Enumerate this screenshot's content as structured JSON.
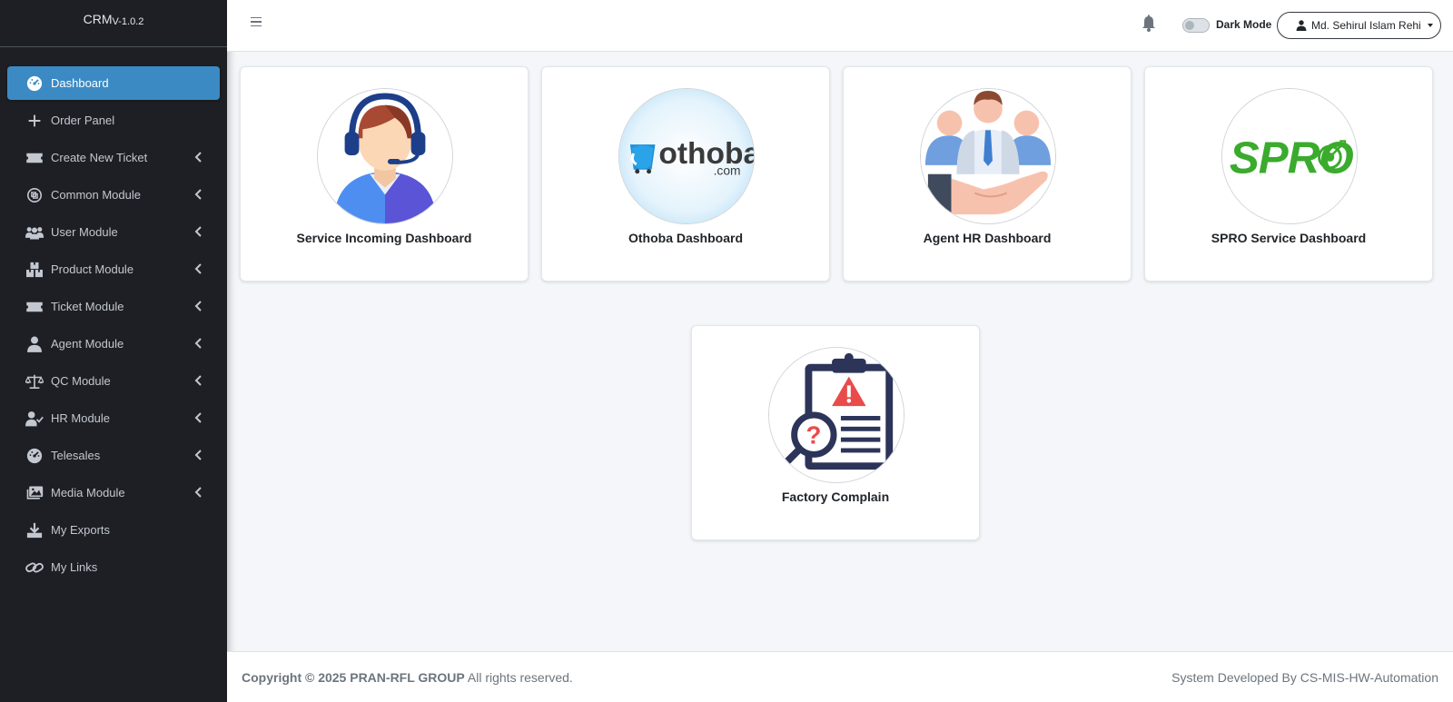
{
  "brand": {
    "name": "CRM",
    "version": "V-1.0.2"
  },
  "sidebar": {
    "items": [
      {
        "label": "Dashboard",
        "icon": "gauge-icon",
        "active": true,
        "has_submenu": false
      },
      {
        "label": "Order Panel",
        "icon": "plus-icon",
        "active": false,
        "has_submenu": false
      },
      {
        "label": "Create New Ticket",
        "icon": "ticket-icon",
        "active": false,
        "has_submenu": true
      },
      {
        "label": "Common Module",
        "icon": "copyright-icon",
        "active": false,
        "has_submenu": true
      },
      {
        "label": "User Module",
        "icon": "users-icon",
        "active": false,
        "has_submenu": true
      },
      {
        "label": "Product Module",
        "icon": "boxes-icon",
        "active": false,
        "has_submenu": true
      },
      {
        "label": "Ticket Module",
        "icon": "ticket-icon",
        "active": false,
        "has_submenu": true
      },
      {
        "label": "Agent Module",
        "icon": "user-icon",
        "active": false,
        "has_submenu": true
      },
      {
        "label": "QC Module",
        "icon": "balance-scale-icon",
        "active": false,
        "has_submenu": true
      },
      {
        "label": "HR Module",
        "icon": "user-check-icon",
        "active": false,
        "has_submenu": true
      },
      {
        "label": "Telesales",
        "icon": "gauge-icon",
        "active": false,
        "has_submenu": true
      },
      {
        "label": "Media Module",
        "icon": "images-icon",
        "active": false,
        "has_submenu": true
      },
      {
        "label": "My Exports",
        "icon": "download-icon",
        "active": false,
        "has_submenu": false
      },
      {
        "label": "My Links",
        "icon": "link-icon",
        "active": false,
        "has_submenu": false
      }
    ]
  },
  "topbar": {
    "menu_icon": "hamburger-icon",
    "notification_icon": "bell-icon",
    "dark_mode_label": "Dark Mode",
    "dark_mode_on": false,
    "user_name": "Md. Sehirul Islam Rehi"
  },
  "cards": [
    {
      "label": "Service Incoming Dashboard",
      "icon": "call-center-agent-icon"
    },
    {
      "label": "Othoba Dashboard",
      "icon": "othoba-logo",
      "logo_text": "othoba",
      "logo_sub": ".com"
    },
    {
      "label": "Agent HR Dashboard",
      "icon": "hr-team-hand-icon"
    },
    {
      "label": "SPRO Service Dashboard",
      "icon": "spro-logo",
      "logo_text": "SPRO"
    },
    {
      "label": "Factory Complain",
      "icon": "clipboard-warning-icon"
    }
  ],
  "footer": {
    "copyright_bold": "Copyright © 2025 PRAN-RFL GROUP",
    "copyright_rest": " All rights reserved.",
    "developer": "System Developed By CS-MIS-HW-Automation"
  },
  "colors": {
    "sidebar_bg": "#1e1f24",
    "active_item": "#3b8ac4",
    "page_bg": "#f4f6f9",
    "spro_green": "#3aab2c",
    "othoba_blue": "#1f8fd6"
  }
}
